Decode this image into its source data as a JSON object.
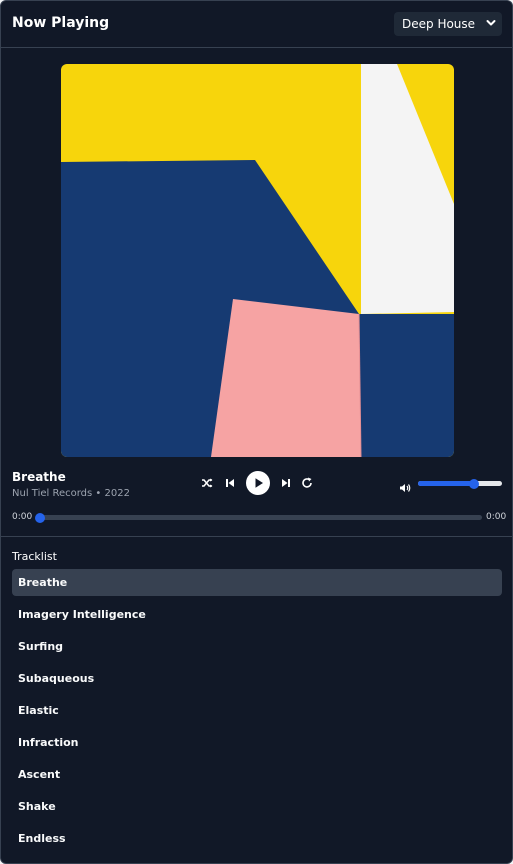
{
  "header": {
    "title": "Now Playing",
    "genre_select": {
      "selected": "Deep House"
    }
  },
  "now_playing": {
    "title": "Breathe",
    "meta": "Nul Tiel Records • 2022",
    "cover_colors": [
      "#f7d50c",
      "#163a72",
      "#f6a3a3",
      "#f4f4f4"
    ]
  },
  "controls": {
    "buttons": [
      "shuffle-icon",
      "skip-back-icon",
      "play-icon",
      "skip-forward-icon",
      "repeat-icon"
    ],
    "volume_level": 0.67
  },
  "progress": {
    "elapsed": "0:00",
    "duration": "0:00",
    "fraction": 0.0
  },
  "tracklist": {
    "label": "Tracklist",
    "active_index": 0,
    "items": [
      "Breathe",
      "Imagery Intelligence",
      "Surfing",
      "Subaqueous",
      "Elastic",
      "Infraction",
      "Ascent",
      "Shake",
      "Endless"
    ]
  },
  "colors": {
    "background": "#111827",
    "surface": "#1f2937",
    "active_row": "#374151",
    "accent": "#2563eb",
    "muted_text": "#9ca3af"
  }
}
